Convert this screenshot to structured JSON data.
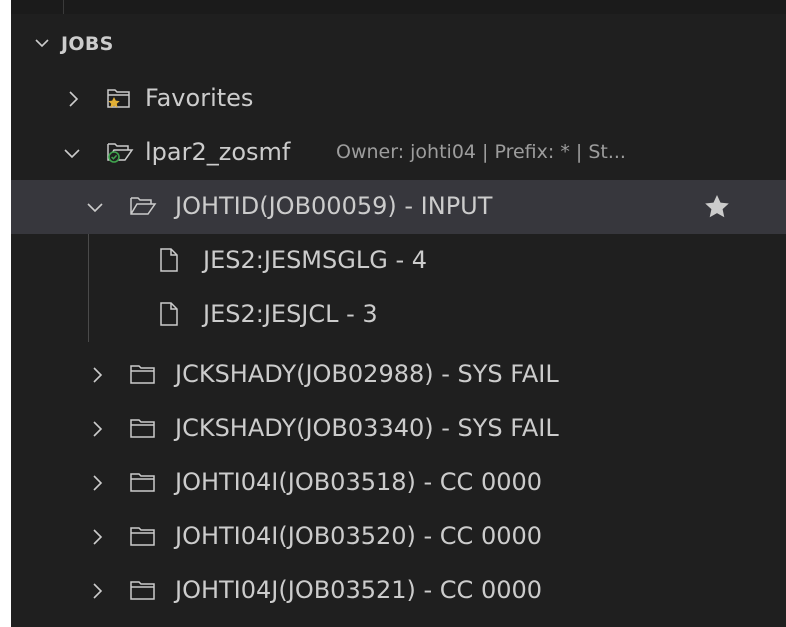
{
  "section": {
    "title": "JOBS"
  },
  "tree": {
    "favorites": {
      "label": "Favorites"
    },
    "profile": {
      "label": "lpar2_zosmf",
      "description": "Owner: johti04 | Prefix: * | St..."
    },
    "selected_job": {
      "label": "JOHTID(JOB00059) - INPUT"
    },
    "spool_files": [
      {
        "label": "JES2:JESMSGLG - 4"
      },
      {
        "label": "JES2:JESJCL - 3"
      }
    ],
    "jobs": [
      {
        "label": "JCKSHADY(JOB02988) - SYS FAIL"
      },
      {
        "label": "JCKSHADY(JOB03340) - SYS FAIL"
      },
      {
        "label": "JOHTI04I(JOB03518) - CC 0000"
      },
      {
        "label": "JOHTI04I(JOB03520) - CC 0000"
      },
      {
        "label": "JOHTI04J(JOB03521) - CC 0000"
      }
    ]
  },
  "colors": {
    "panel_bg": "#1f1f1f",
    "selected_bg": "#37373d",
    "text": "#cccccc",
    "description": "#9d9d9d",
    "favorites_star": "#e2b035",
    "connected_badge": "#3fa34d"
  },
  "icons": {
    "section_toggle": "chevron-down-icon",
    "collapsed": "chevron-right-icon",
    "expanded": "chevron-down-icon",
    "favorites": "folder-star-icon",
    "profile": "folder-connected-icon",
    "open_job": "folder-open-icon",
    "closed_job": "folder-icon",
    "spool_file": "file-icon",
    "favorite_action": "star-icon"
  }
}
